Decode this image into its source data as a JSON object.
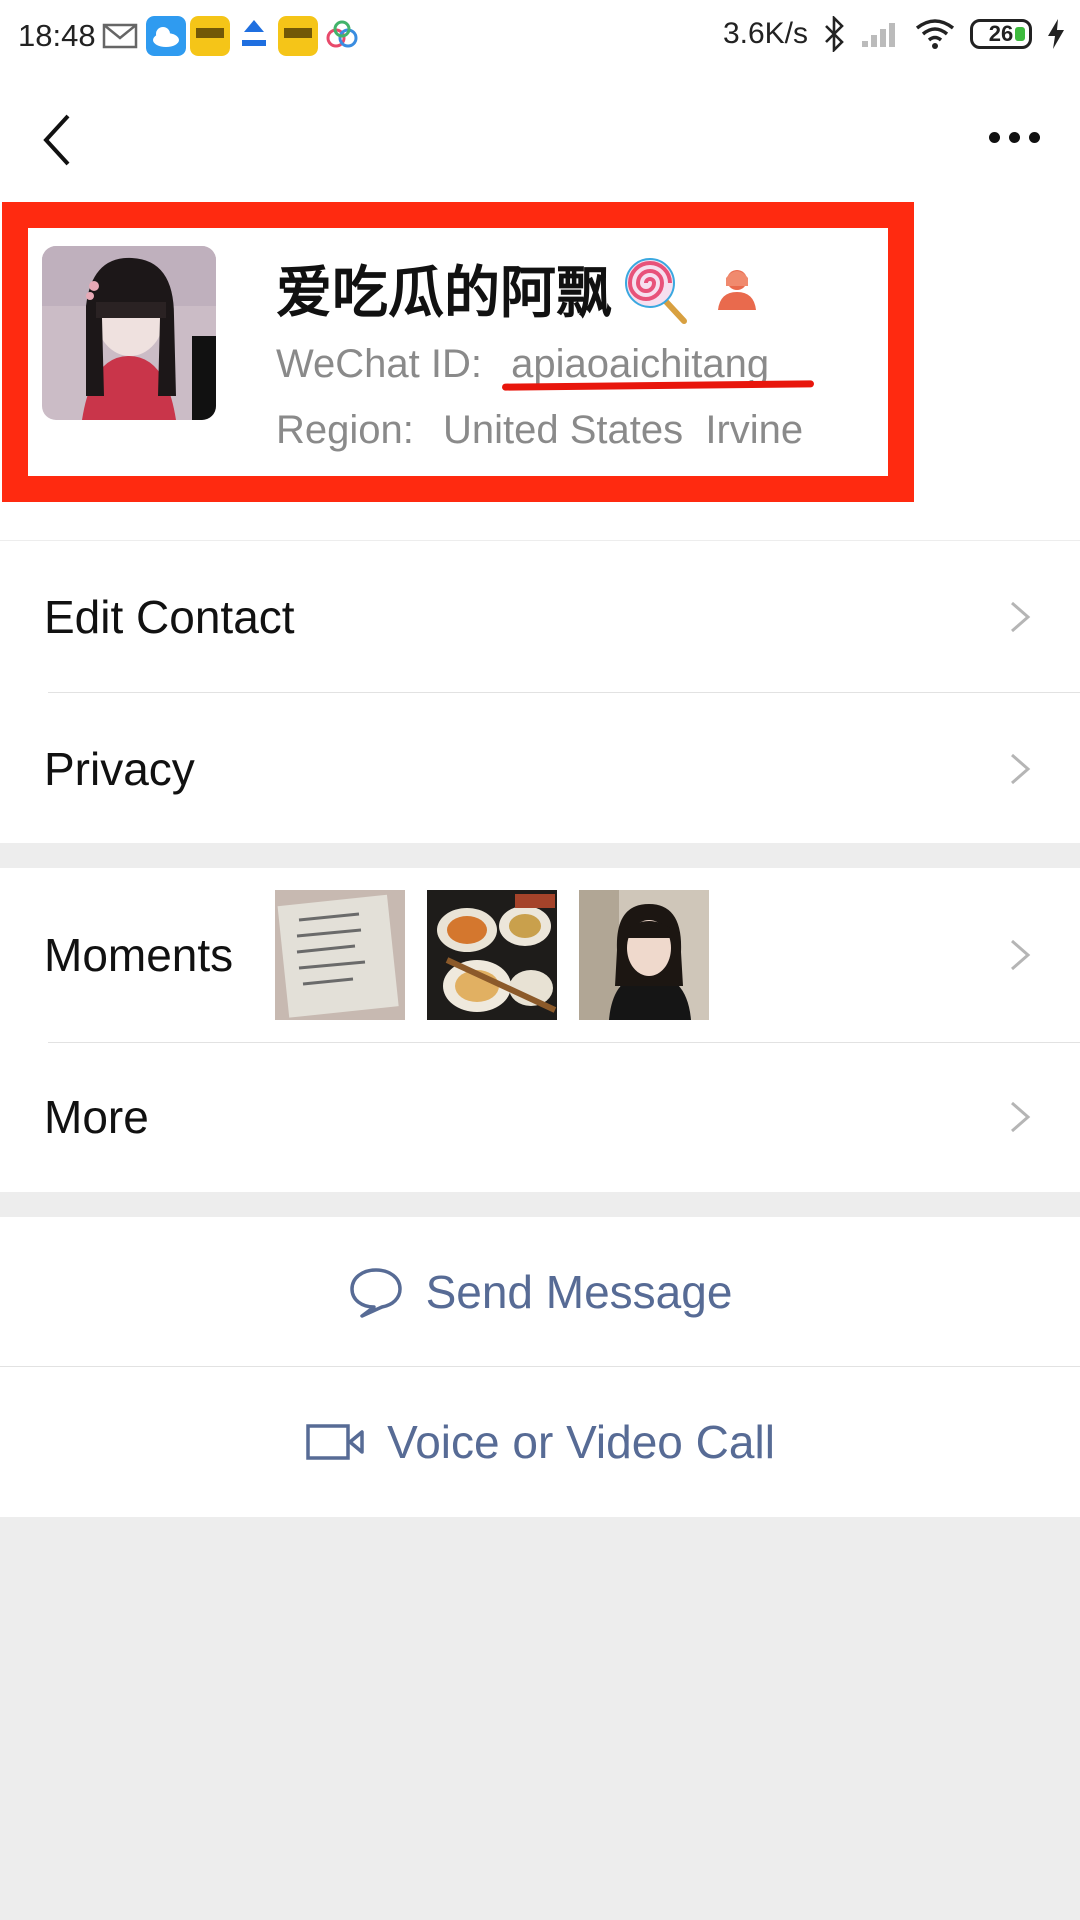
{
  "status_bar": {
    "time": "18:48",
    "network_speed": "3.6K/s",
    "battery": "26",
    "notification_icons": [
      "mail-icon",
      "cloud-icon",
      "app-icon",
      "app-icon",
      "app-icon",
      "app-icon"
    ]
  },
  "navbar": {
    "back_icon": "chevron-left-icon",
    "more_icon": "more-dots-icon"
  },
  "profile": {
    "name": "爱吃瓜的阿飘",
    "wechat_id_label": "WeChat ID:",
    "wechat_id": "apiaoaichitang",
    "region_label": "Region:",
    "region_value": "United States  Irvine",
    "highlight_color": "#ff2a10"
  },
  "menu": {
    "edit_contact": "Edit Contact",
    "privacy": "Privacy",
    "moments": "Moments",
    "more": "More"
  },
  "actions": {
    "send_message": "Send Message",
    "voice_video_call": "Voice or Video Call",
    "link_color": "#576b95"
  }
}
